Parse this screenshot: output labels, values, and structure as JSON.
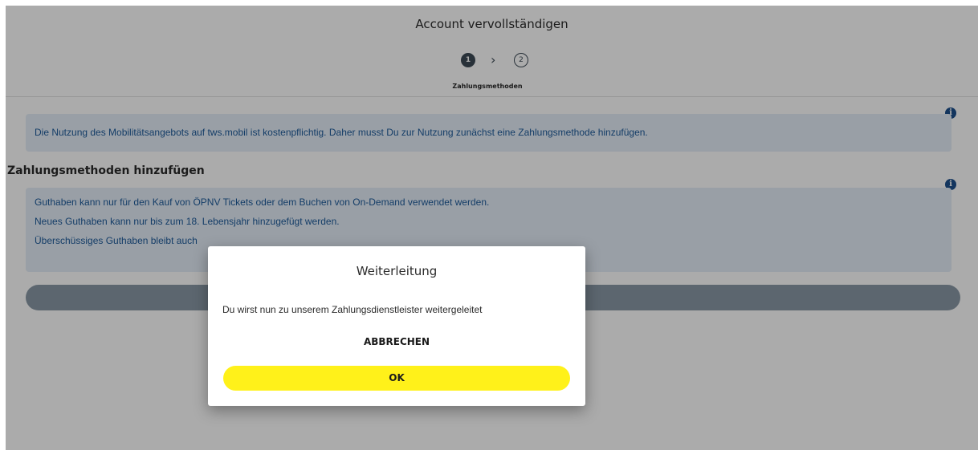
{
  "header": {
    "title": "Account vervollständigen",
    "steps": [
      {
        "number": "1",
        "status": "active"
      },
      {
        "number": "2",
        "status": "inactive"
      }
    ],
    "step_separator": "›",
    "step_label": "Zahlungsmethoden"
  },
  "main": {
    "notice": "Die Nutzung des Mobilitätsangebots auf tws.mobil ist kostenpflichtig. Daher musst Du zur Nutzung zunächst eine Zahlungsmethode hinzufügen.",
    "section_title": "Zahlungsmethoden hinzufügen",
    "info_lines": [
      "Guthaben kann nur für den Kauf von ÖPNV Tickets oder dem Buchen von On-Demand verwendet werden.",
      "Neues Guthaben kann nur bis zum 18. Lebensjahr hinzugefügt werden.",
      "Überschüssiges Guthaben bleibt auch"
    ],
    "info_icon": "i"
  },
  "dialog": {
    "title": "Weiterleitung",
    "message": "Du wirst nun zu unserem Zahlungsdienstleister weitergeleitet",
    "cancel_label": "ABBRECHEN",
    "ok_label": "OK"
  },
  "colors": {
    "accent_yellow": "#fff11a",
    "info_blue": "#1d5a9a",
    "info_bg": "#e4eef8",
    "step_active": "#3d4a55"
  }
}
